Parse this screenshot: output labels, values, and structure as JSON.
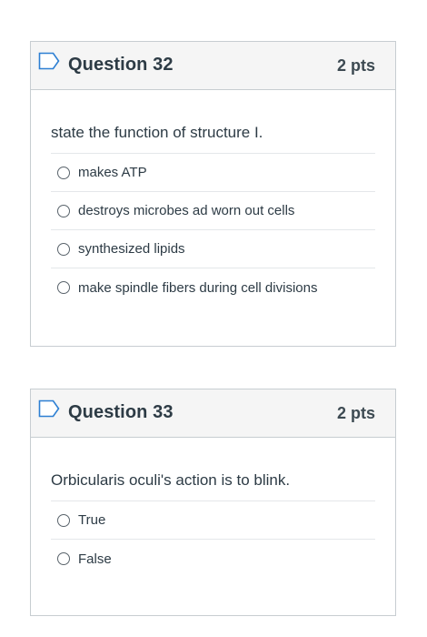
{
  "questions": [
    {
      "title": "Question 32",
      "points": "2 pts",
      "text": "state the function of structure I.",
      "answers": [
        "makes ATP",
        "destroys microbes ad worn out cells",
        "synthesized lipids",
        "make spindle fibers during cell divisions"
      ]
    },
    {
      "title": "Question 33",
      "points": "2 pts",
      "text": "Orbicularis oculi's action is to blink.",
      "answers": [
        "True",
        "False"
      ]
    }
  ],
  "icons": {
    "flag": "flag-icon"
  },
  "colors": {
    "header_bg": "#f5f5f5",
    "border": "#c7cdd1",
    "text": "#2d3b45",
    "flag_stroke": "#2d7fd3"
  }
}
